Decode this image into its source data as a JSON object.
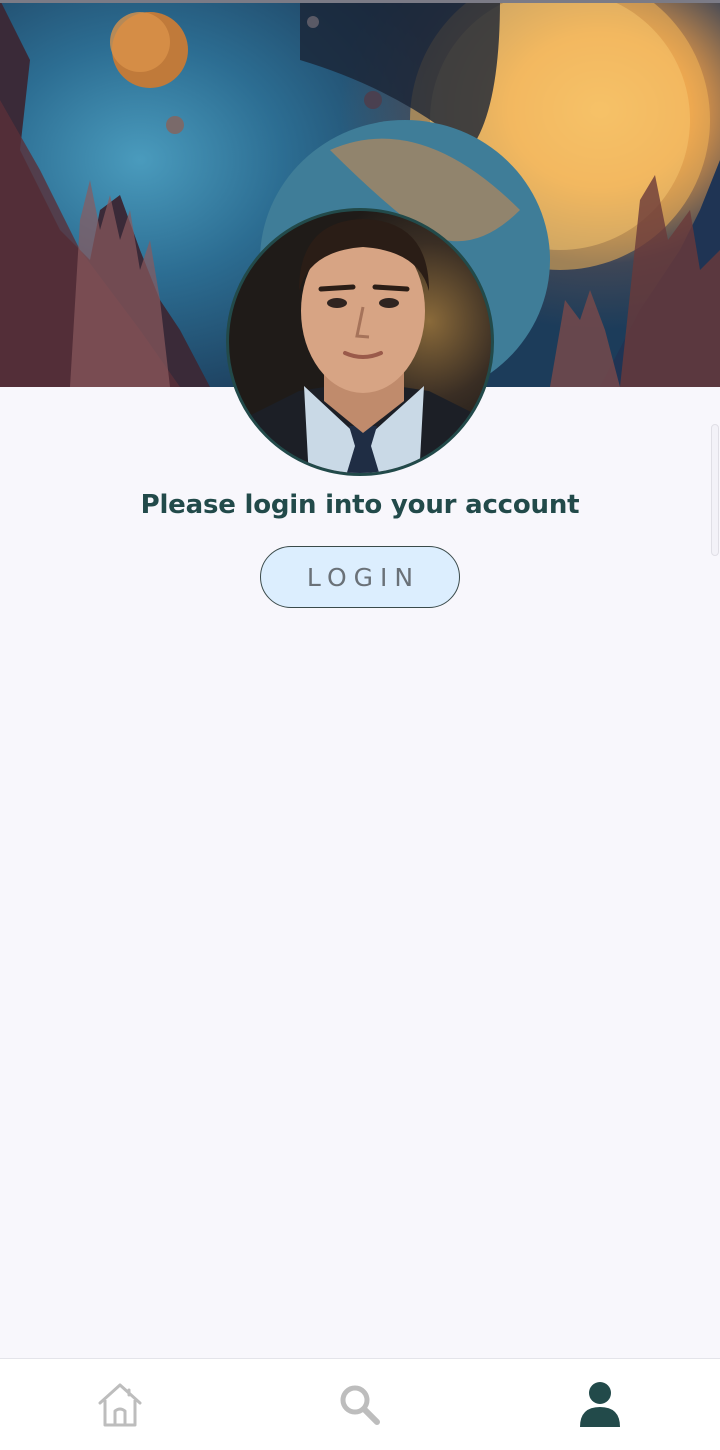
{
  "banner": {
    "image": "space-planets-landscape"
  },
  "profile": {
    "avatar": "man-in-suit-portrait"
  },
  "prompt": "Please login into your account",
  "login_button": "LOGIN",
  "bottom_nav": {
    "items": [
      {
        "icon": "home-icon",
        "active": false
      },
      {
        "icon": "search-icon",
        "active": false
      },
      {
        "icon": "person-icon",
        "active": true
      }
    ]
  },
  "colors": {
    "accent": "#224a4a",
    "button_bg": "#dceefe",
    "button_text": "#6a7178",
    "inactive_icon": "#bdbdbd",
    "page_bg": "#f8f7fc"
  }
}
